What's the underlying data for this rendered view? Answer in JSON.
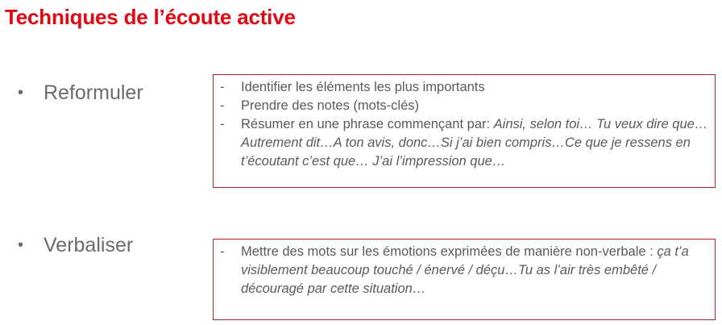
{
  "title": "Techniques de l’écoute active",
  "sections": [
    {
      "label": "Reformuler",
      "bullet": "•",
      "items": [
        {
          "dash": "-",
          "text": "Identifier les éléments les plus importants",
          "italic": ""
        },
        {
          "dash": "-",
          "text": "Prendre des notes (mots-clés)",
          "italic": ""
        },
        {
          "dash": "-",
          "text": "Résumer en une phrase commençant par: ",
          "italic": "Ainsi, selon toi… Tu veux dire que…Autrement dit…A ton avis, donc…Si j’ai bien compris…Ce que je ressens en t’écoutant c’est que… J’ai l’impression que…"
        }
      ]
    },
    {
      "label": "Verbaliser",
      "bullet": "•",
      "items": [
        {
          "dash": "-",
          "text": "Mettre des mots sur les émotions exprimées de manière non-verbale : ",
          "italic": "ça t’a visiblement beaucoup touché / énervé / déçu…Tu as l’air très embêté / découragé par cette situation…"
        }
      ]
    }
  ],
  "colors": {
    "title": "#e30613",
    "box_border": "#b3202a",
    "label_text": "#6b6b6b",
    "body_text": "#5a5a5a"
  }
}
